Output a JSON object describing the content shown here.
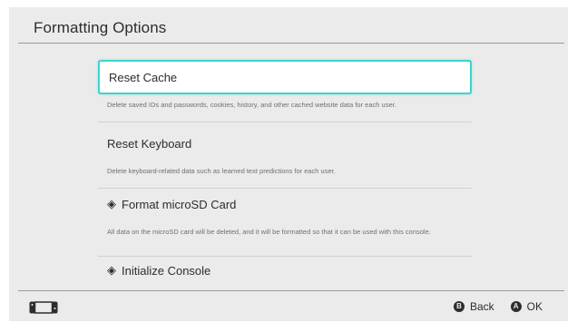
{
  "header": {
    "title": "Formatting Options"
  },
  "items": [
    {
      "label": "Reset Cache",
      "icon": "",
      "description": "Delete saved IDs and passwords, cookies, history, and other cached website data for each user."
    },
    {
      "label": "Reset Keyboard",
      "icon": "",
      "description": "Delete keyboard-related data such as learned text predictions for each user."
    },
    {
      "label": "Format microSD Card",
      "icon": "◈",
      "description": "All data on the microSD card will be deleted, and it will be formatted so that it can be used with this console."
    },
    {
      "label": "Initialize Console",
      "icon": "◈",
      "description": ""
    }
  ],
  "footer": {
    "back": {
      "key": "B",
      "label": "Back"
    },
    "ok": {
      "key": "A",
      "label": "OK"
    }
  },
  "colors": {
    "accent": "#3fd3d0",
    "background": "#ebebeb"
  },
  "icons": {
    "console": "switch-console-icon",
    "warning": "diamond-warning-icon"
  }
}
